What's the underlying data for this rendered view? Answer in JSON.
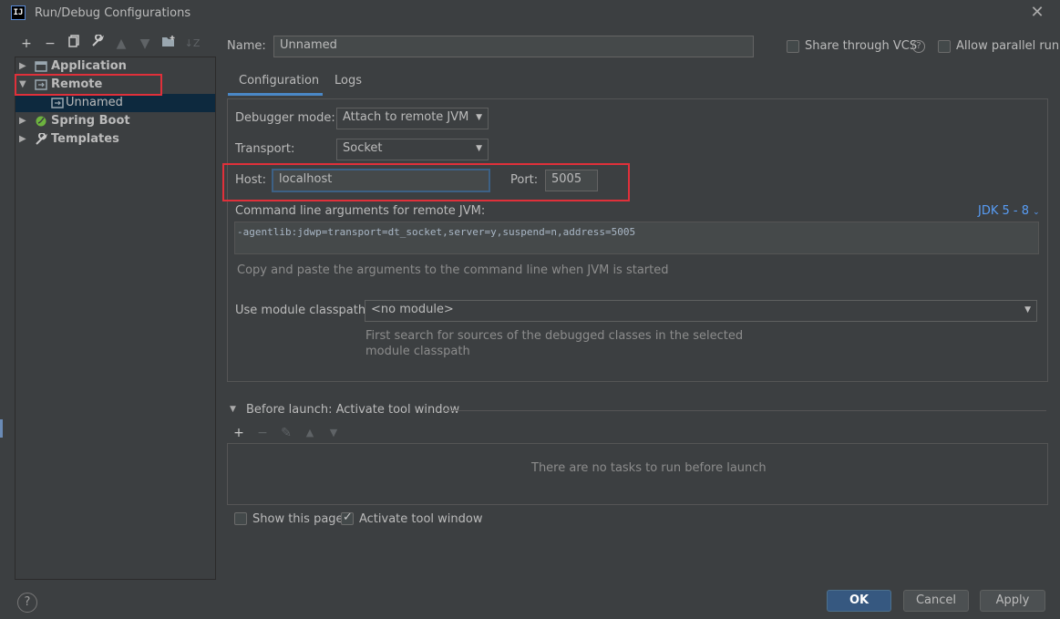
{
  "window": {
    "title": "Run/Debug Configurations",
    "app_icon": "IJ"
  },
  "toolbar": {
    "icons": [
      "add-icon",
      "remove-icon",
      "copy-icon",
      "wrench-icon",
      "move-up-icon",
      "move-down-icon",
      "folder-icon",
      "sort-icon"
    ]
  },
  "tree": {
    "items": [
      {
        "label": "Application",
        "expanded": false
      },
      {
        "label": "Remote",
        "expanded": true
      },
      {
        "label": "Unnamed",
        "selected": true
      },
      {
        "label": "Spring Boot",
        "expanded": false
      },
      {
        "label": "Templates",
        "expanded": false
      }
    ]
  },
  "name_field": {
    "label": "Name:",
    "value": "Unnamed"
  },
  "share_vcs": {
    "label": "Share through VCS",
    "checked": false
  },
  "allow_parallel": {
    "label": "Allow parallel run",
    "checked": false
  },
  "tabs": [
    {
      "label": "Configuration",
      "active": true
    },
    {
      "label": "Logs",
      "active": false
    }
  ],
  "config": {
    "debugger_mode": {
      "label": "Debugger mode:",
      "value": "Attach to remote JVM"
    },
    "transport": {
      "label": "Transport:",
      "value": "Socket"
    },
    "host": {
      "label": "Host:",
      "value": "localhost"
    },
    "port": {
      "label": "Port:",
      "value": "5005"
    },
    "cmd_args": {
      "label": "Command line arguments for remote JVM:",
      "jdk": "JDK 5 - 8",
      "value": "-agentlib:jdwp=transport=dt_socket,server=y,suspend=n,address=5005",
      "hint": "Copy and paste the arguments to the command line when JVM is started"
    },
    "module_classpath": {
      "label": "Use module classpath:",
      "value": "<no module>",
      "hint_line1": "First search for sources of the debugged classes in the selected",
      "hint_line2": "module classpath"
    }
  },
  "before_launch": {
    "title": "Before launch: Activate tool window",
    "empty_text": "There are no tasks to run before launch"
  },
  "show_page": {
    "label": "Show this page",
    "checked": false
  },
  "activate_tool": {
    "label": "Activate tool window",
    "checked": true
  },
  "buttons": {
    "ok": "OK",
    "cancel": "Cancel",
    "apply": "Apply",
    "help": "?"
  },
  "colors": {
    "accent": "#4a88c7",
    "highlight_box": "#e0303a",
    "background": "#3c3f41"
  }
}
